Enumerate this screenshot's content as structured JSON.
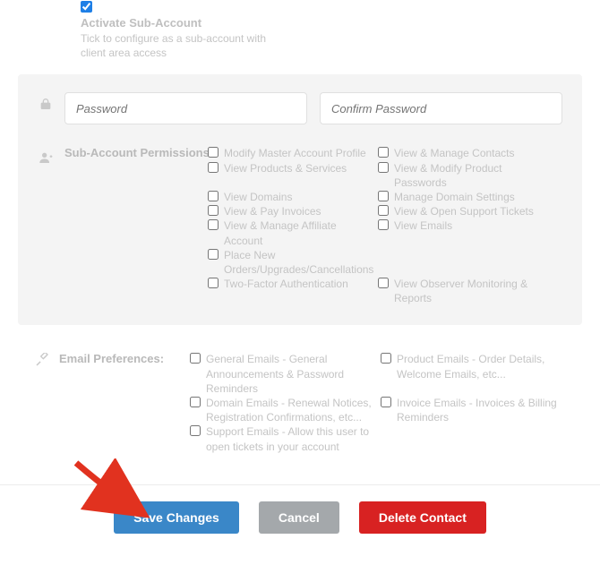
{
  "activate": {
    "label": "Activate Sub-Account",
    "help": "Tick to configure as a sub-account with client area access"
  },
  "password": {
    "placeholder": "Password",
    "confirm_placeholder": "Confirm Password"
  },
  "perm": {
    "title": "Sub-Account Permissions:",
    "col1": [
      "Modify Master Account Profile",
      "View Products & Services",
      "View Domains",
      "View & Pay Invoices",
      "View & Manage Affiliate Account",
      "Place New Orders/Upgrades/Cancellations",
      "Two-Factor Authentication"
    ],
    "col2": [
      "View & Manage Contacts",
      "View & Modify Product Passwords",
      "Manage Domain Settings",
      "View & Open Support Tickets",
      "View Emails",
      "",
      "View Observer Monitoring & Reports"
    ]
  },
  "email": {
    "title": "Email Preferences:",
    "col1": [
      "General Emails - General Announcements & Password Reminders",
      "Domain Emails - Renewal Notices, Registration Confirmations, etc...",
      "Support Emails - Allow this user to open tickets in your account"
    ],
    "col2": [
      "Product Emails - Order Details, Welcome Emails, etc...",
      "Invoice Emails - Invoices & Billing Reminders"
    ]
  },
  "buttons": {
    "save": "Save Changes",
    "cancel": "Cancel",
    "delete": "Delete Contact"
  }
}
